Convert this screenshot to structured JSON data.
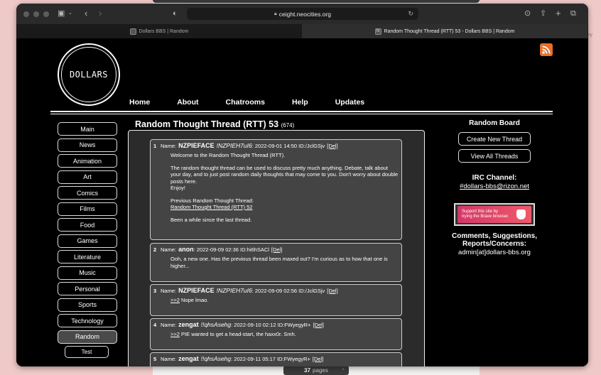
{
  "browser": {
    "url": "ceight.neocities.org",
    "tabs": [
      {
        "title": "Dollars BBS | Random",
        "active": false
      },
      {
        "title": "Random Thought Thread (RTT) 53 - Dollars BBS | Random",
        "active": true,
        "favicon": "N"
      }
    ]
  },
  "background": {
    "pages_count": "37",
    "pages_label": "pages",
    "edge_text": "ry"
  },
  "site": {
    "logo_text": "DOLLARS",
    "nav": [
      "Home",
      "About",
      "Chatrooms",
      "Help",
      "Updates"
    ],
    "sidebar": [
      "Main",
      "News",
      "Animation",
      "Art",
      "Comics",
      "Films",
      "Food",
      "Games",
      "Literature",
      "Music",
      "Personal",
      "Sports",
      "Technology",
      "Random"
    ],
    "sidebar_selected": "Random",
    "sidebar_test": "Test"
  },
  "thread": {
    "title": "Random Thought Thread (RTT) 53",
    "count": "(674)",
    "name_label": "Name:",
    "del_label": "[Del]",
    "posts": [
      {
        "num": "1",
        "name": "NZPIEFACE",
        "trip": "!NZPIEH7uI6",
        "meta": ": 2022-09-01 14:50 ID:/JclGSjv",
        "lines": [
          "Welcome to the Random Thought Thread (RTT).",
          "The random thought thread can be used to discuss pretty much anything. Debate, talk about your day, and to just post random daily thoughts that may come to you. Don't worry about double posts here.",
          "Enjoy!",
          "Previous Random Thought Thread:",
          "Random Thought Thread (RTT) 52",
          "Been a while since the last thread."
        ]
      },
      {
        "num": "2",
        "name": "anon",
        "trip": "",
        "meta": ": 2022-09-09 02:36 ID:hi6hSACl",
        "lines": [
          "Ooh, a new one. Has the previous thread been maxed out? I'm curious as to how that one is higher..."
        ]
      },
      {
        "num": "3",
        "name": "NZPIEFACE",
        "trip": "!NZPIEH7uI6",
        "meta": ": 2022-09-09 02:56 ID:/JclGSjv",
        "lines": [
          ">>2",
          " Nope lmao."
        ]
      },
      {
        "num": "4",
        "name": "zengat",
        "trip": "!!qhsAsehg",
        "meta": ": 2022-09-10 02:12 ID:FWyegyR+",
        "lines": [
          ">>2",
          " PIE wanted to get a head-start, the haxx0r. Smh."
        ]
      },
      {
        "num": "5",
        "name": "zengat",
        "trip": "!!qhsAsehg",
        "meta": ": 2022-09-11 05:17 ID:FWyegyR+",
        "lines": []
      }
    ]
  },
  "right": {
    "board_title": "Random Board",
    "create_button": "Create New Thread",
    "view_button": "View All Threads",
    "irc_label": "IRC Channel:",
    "irc_link": "#dollars-bbs@rizon.net",
    "brave_line1": "Support this site by",
    "brave_line2": "trying the Brave browser.",
    "comments_line1": "Comments, Suggestions,",
    "comments_line2": "Reports/Concerns:",
    "email": "admin[at]dollars-bbs.org"
  },
  "colors": {
    "page_bg": "#000000",
    "post_bg": "#444444",
    "board_bg": "#2b2b2b",
    "rss": "#e8702a",
    "brave": "#d23867"
  }
}
